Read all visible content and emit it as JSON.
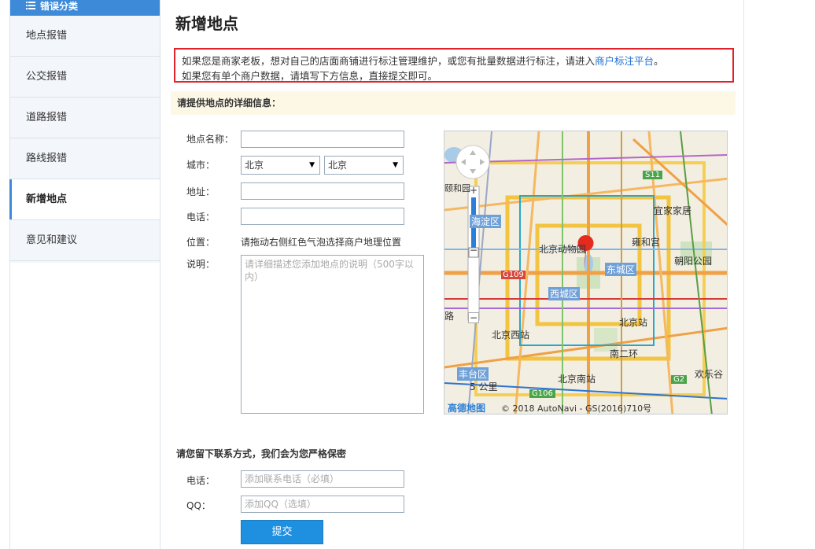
{
  "sidebar": {
    "header": "错误分类",
    "items": [
      {
        "label": "地点报错"
      },
      {
        "label": "公交报错"
      },
      {
        "label": "道路报错"
      },
      {
        "label": "路线报错"
      },
      {
        "label": "新增地点"
      },
      {
        "label": "意见和建议"
      }
    ],
    "active_index": 4
  },
  "main": {
    "title": "新增地点",
    "notice_line1_pre": "如果您是商家老板，想对自己的店面商铺进行标注管理维护，或您有批量数据进行标注，请进入",
    "notice_link": "商户标注平台",
    "notice_line1_post": "。",
    "notice_line2": "如果您有单个商户数据，请填写下方信息，直接提交即可。",
    "section_title": "请提供地点的详细信息：",
    "form": {
      "name_label": "地点名称：",
      "city_label": "城市：",
      "city_value1": "北京",
      "city_value2": "北京",
      "address_label": "地址：",
      "phone_label": "电话：",
      "position_label": "位置：",
      "position_text": "请拖动右侧红色气泡选择商户地理位置",
      "desc_label": "说明：",
      "desc_placeholder": "请详细描述您添加地点的说明（500字以内）"
    },
    "map": {
      "labels": {
        "s11": "S11",
        "haidian": "海淀区",
        "zoo": "北京动物园",
        "yonghegong": "雍和宫",
        "yijiajiaju": "宜家家居",
        "chaoyang_park": "朝阳公园",
        "dongcheng": "东城区",
        "xicheng": "西城区",
        "g109": "G109",
        "beijing_station": "北京站",
        "beijing_west": "北京西站",
        "nan_erhuan": "南二环",
        "fengtai": "丰台区",
        "beijing_south": "北京南站",
        "g2": "G2",
        "huanlegu": "欢乐谷",
        "g106": "G106",
        "scale": "5 公里",
        "lu": "路",
        "yiheyuan": "颐和园",
        "copyright": "© 2018 AutoNavi - GS(2016)710号",
        "brand": "高德地图"
      },
      "zoom_in": "+",
      "zoom_out": "−"
    },
    "contact": {
      "title": "请您留下联系方式，我们会为您严格保密",
      "phone_label": "电话：",
      "phone_placeholder": "添加联系电话（必填）",
      "qq_label": "QQ：",
      "qq_placeholder": "添加QQ（选填）"
    },
    "submit_label": "提交"
  },
  "colors": {
    "accent": "#3d8ad8",
    "notice_border": "#e0232b",
    "link": "#1a6ed0",
    "submit": "#1f8fe0",
    "section_bg": "#fdf8e6"
  }
}
